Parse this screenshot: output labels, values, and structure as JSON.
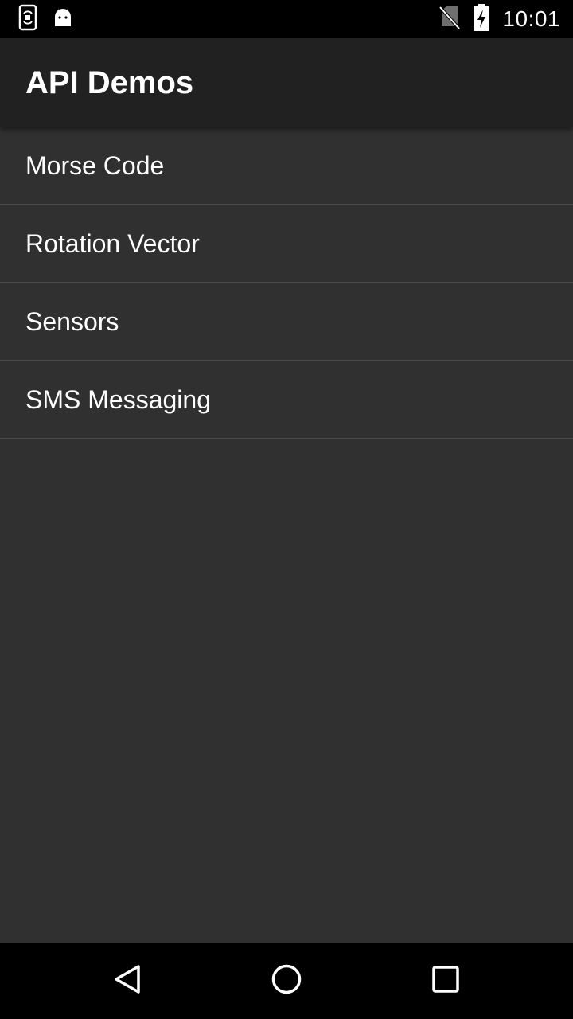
{
  "status_bar": {
    "time": "10:01",
    "left_icons": [
      "screen-rotation-icon",
      "android-icon"
    ],
    "right_icons": [
      "no-sim-icon",
      "battery-charging-icon"
    ]
  },
  "app_bar": {
    "title": "API Demos"
  },
  "list": {
    "items": [
      {
        "label": "Morse Code"
      },
      {
        "label": "Rotation Vector"
      },
      {
        "label": "Sensors"
      },
      {
        "label": "SMS Messaging"
      }
    ]
  },
  "nav_bar": {
    "buttons": [
      "back-icon",
      "home-icon",
      "recents-icon"
    ]
  },
  "colors": {
    "status_bar_bg": "#000000",
    "app_bar_bg": "#212121",
    "content_bg": "#303030",
    "divider": "#4a4a4a",
    "text": "#ffffff"
  }
}
